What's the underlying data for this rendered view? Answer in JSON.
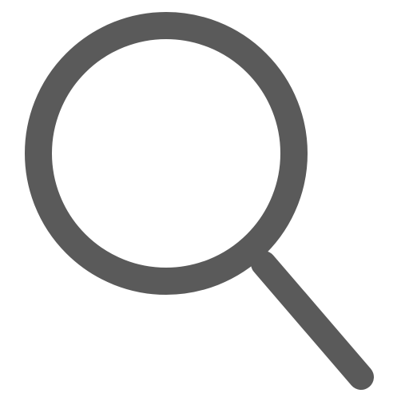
{
  "icon": {
    "name": "search-icon",
    "color": "#5a5a5a",
    "background": "#ffffff"
  }
}
